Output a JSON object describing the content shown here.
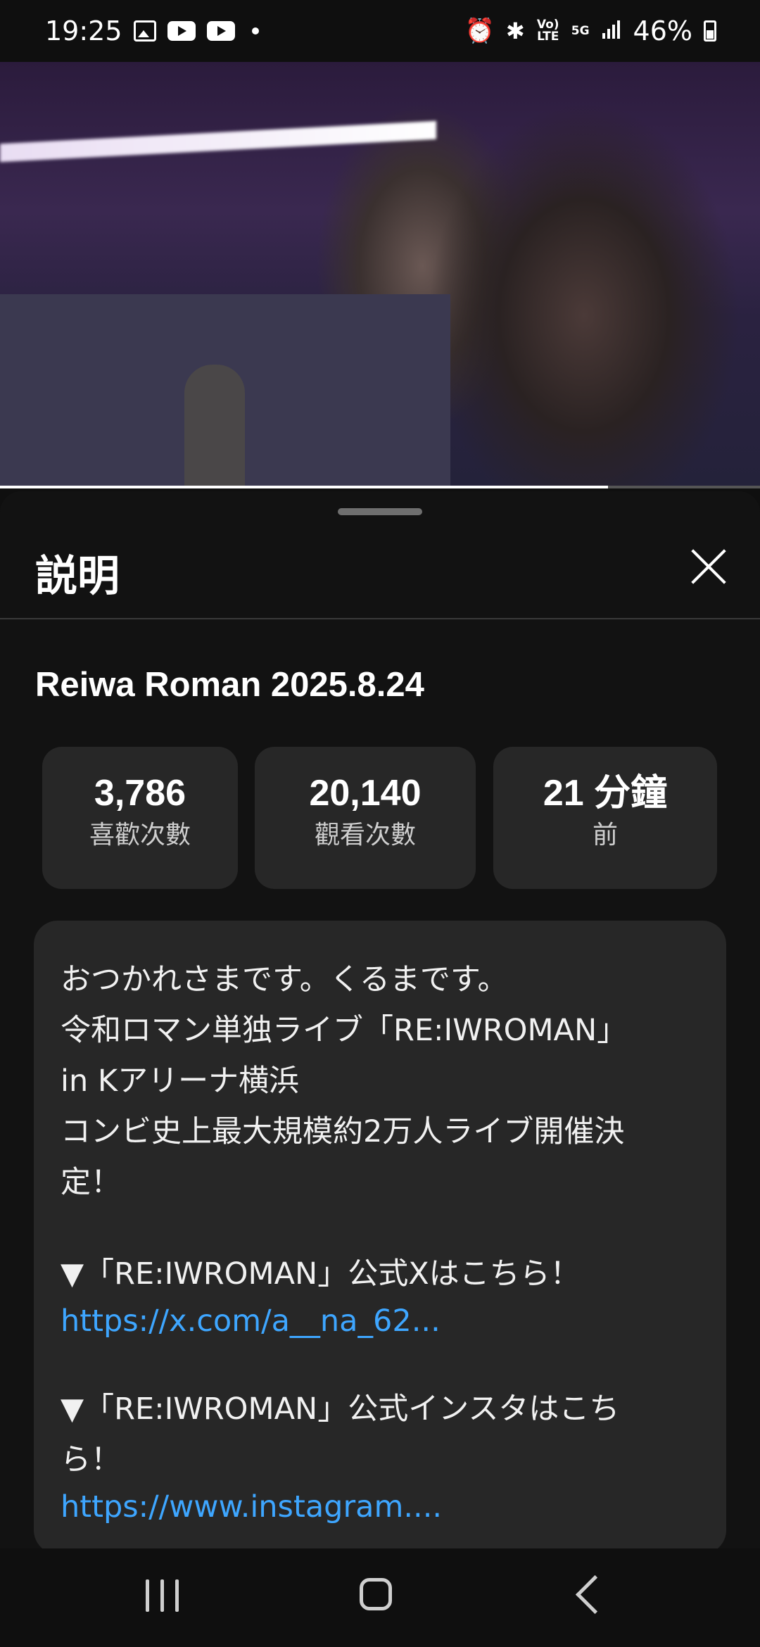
{
  "status_bar": {
    "time": "19:25",
    "signal_5g": "5G",
    "volte": "Vo) LTE",
    "battery": "46%"
  },
  "video": {
    "progress": 0.8
  },
  "sheet": {
    "title": "説明",
    "close_icon": "close-icon"
  },
  "video_info": {
    "title": "Reiwa Roman 2025.8.24",
    "stats": [
      {
        "value": "3,786",
        "label": "喜歡次數"
      },
      {
        "value": "20,140",
        "label": "觀看次數"
      },
      {
        "value": "21 分鐘",
        "label": "前"
      }
    ]
  },
  "description": {
    "lines": [
      "おつかれさまです。くるまです。",
      "令和ロマン単独ライブ「RE:IWROMAN」",
      "in Kアリーナ横浜",
      "コンビ史上最大規模約2万人ライブ開催決",
      "定！"
    ],
    "section1_heading": "▼「RE:IWROMAN」公式Xはこちら！",
    "section1_link": "https://x.com/a__na_62...",
    "section2_heading_1": "▼「RE:IWROMAN」公式インスタはこち",
    "section2_heading_2": "ら！",
    "section2_link": "https://www.instagram...."
  },
  "nav_bar": {
    "recent_icon": "recent-apps-icon",
    "home_icon": "home-icon",
    "back_icon": "back-icon"
  }
}
